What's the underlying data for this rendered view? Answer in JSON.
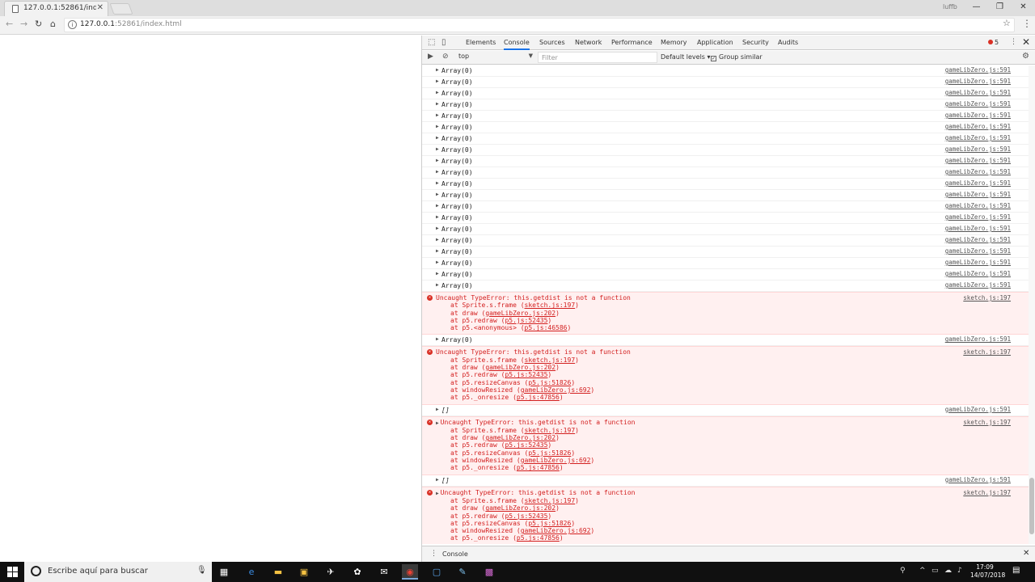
{
  "browser": {
    "tab_title": "127.0.0.1:52861/index.ht",
    "url_host": "127.0.0.1",
    "url_path": ":52861/index.html",
    "user_label": "luffb"
  },
  "devtools": {
    "tabs": [
      "Elements",
      "Console",
      "Sources",
      "Network",
      "Performance",
      "Memory",
      "Application",
      "Security",
      "Audits"
    ],
    "active_tab": "Console",
    "error_count": "5",
    "context": "top",
    "filter_placeholder": "Filter",
    "levels_label": "Default levels",
    "group_similar_label": "Group similar",
    "drawer_label": "Console"
  },
  "console": {
    "array_rows": [
      "Array(0)",
      "Array(0)",
      "Array(0)",
      "Array(0)",
      "Array(0)",
      "Array(0)",
      "Array(0)",
      "Array(0)",
      "Array(0)",
      "Array(0)",
      "Array(0)",
      "Array(0)",
      "Array(0)",
      "Array(0)",
      "Array(0)",
      "Array(0)",
      "Array(0)",
      "Array(0)",
      "Array(0)",
      "Array(0)"
    ],
    "row_source": "gameLibZero.js:591",
    "error_source": "sketch.js:197",
    "error1": {
      "message": "Uncaught TypeError: this.getdist is not a function",
      "stack": [
        {
          "pre": "at Sprite.s.frame (",
          "link": "sketch.js:197",
          "post": ")"
        },
        {
          "pre": "at draw (",
          "link": "gameLibZero.js:202",
          "post": ")"
        },
        {
          "pre": "at p5.redraw (",
          "link": "p5.js:52435",
          "post": ")"
        },
        {
          "pre": "at p5.<anonymous> (",
          "link": "p5.js:46586",
          "post": ")"
        }
      ]
    },
    "array_after_1": "Array(0)",
    "error2": {
      "message": "Uncaught TypeError: this.getdist is not a function",
      "stack": [
        {
          "pre": "at Sprite.s.frame (",
          "link": "sketch.js:197",
          "post": ")"
        },
        {
          "pre": "at draw (",
          "link": "gameLibZero.js:202",
          "post": ")"
        },
        {
          "pre": "at p5.redraw (",
          "link": "p5.js:52435",
          "post": ")"
        },
        {
          "pre": "at p5.resizeCanvas (",
          "link": "p5.js:51826",
          "post": ")"
        },
        {
          "pre": "at windowResized (",
          "link": "gameLibZero.js:692",
          "post": ")"
        },
        {
          "pre": "at p5._onresize (",
          "link": "p5.js:47856",
          "post": ")"
        }
      ]
    },
    "empty_array_1": "[]",
    "error3": {
      "message": "Uncaught TypeError: this.getdist is not a function",
      "stack": [
        {
          "pre": "at Sprite.s.frame (",
          "link": "sketch.js:197",
          "post": ")"
        },
        {
          "pre": "at draw (",
          "link": "gameLibZero.js:202",
          "post": ")"
        },
        {
          "pre": "at p5.redraw (",
          "link": "p5.js:52435",
          "post": ")"
        },
        {
          "pre": "at p5.resizeCanvas (",
          "link": "p5.js:51826",
          "post": ")"
        },
        {
          "pre": "at windowResized (",
          "link": "gameLibZero.js:692",
          "post": ")"
        },
        {
          "pre": "at p5._onresize (",
          "link": "p5.js:47856",
          "post": ")"
        }
      ]
    },
    "empty_array_2": "[]",
    "error4": {
      "message": "Uncaught TypeError: this.getdist is not a function",
      "stack": [
        {
          "pre": "at Sprite.s.frame (",
          "link": "sketch.js:197",
          "post": ")"
        },
        {
          "pre": "at draw (",
          "link": "gameLibZero.js:202",
          "post": ")"
        },
        {
          "pre": "at p5.redraw (",
          "link": "p5.js:52435",
          "post": ")"
        },
        {
          "pre": "at p5.resizeCanvas (",
          "link": "p5.js:51826",
          "post": ")"
        },
        {
          "pre": "at windowResized (",
          "link": "gameLibZero.js:692",
          "post": ")"
        },
        {
          "pre": "at p5._onresize (",
          "link": "p5.js:47856",
          "post": ")"
        }
      ]
    },
    "prompt": ">"
  },
  "taskbar": {
    "search_placeholder": "Escribe aquí para buscar",
    "time": "17:09",
    "date": "14/07/2018"
  },
  "colors": {
    "error_bg": "#fff0f0",
    "error_text": "#d32020",
    "accent": "#1a73e8"
  }
}
